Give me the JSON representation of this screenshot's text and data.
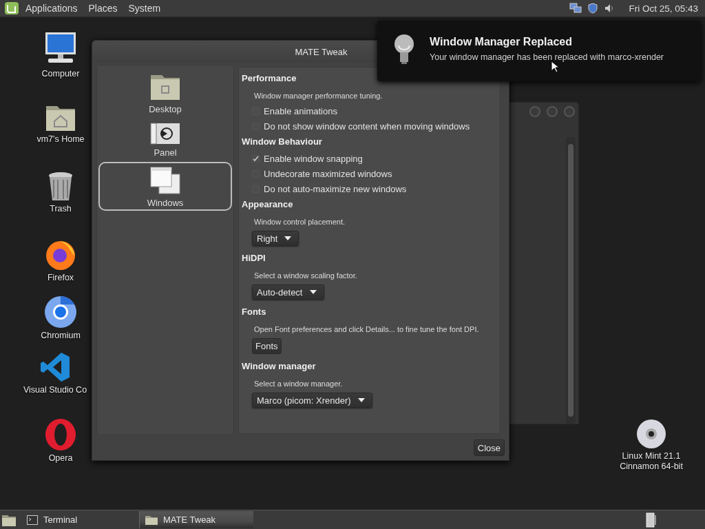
{
  "top_panel": {
    "menus": [
      "Applications",
      "Places",
      "System"
    ],
    "clock": "Fri Oct 25, 05:43"
  },
  "desktop_icons": [
    {
      "kind": "computer",
      "label": "Computer"
    },
    {
      "kind": "home",
      "label": "vm7's Home"
    },
    {
      "kind": "trash",
      "label": "Trash"
    },
    {
      "kind": "firefox",
      "label": "Firefox"
    },
    {
      "kind": "chromium",
      "label": "Chromium"
    },
    {
      "kind": "vscode",
      "label": "Visual Studio Co"
    },
    {
      "kind": "opera",
      "label": "Opera"
    },
    {
      "kind": "disc",
      "label": "Linux Mint 21.1 Cinnamon 64-bit"
    }
  ],
  "window": {
    "title": "MATE Tweak",
    "sidebar": [
      {
        "kind": "desktop",
        "label": "Desktop",
        "selected": false
      },
      {
        "kind": "panel",
        "label": "Panel",
        "selected": false
      },
      {
        "kind": "windows",
        "label": "Windows",
        "selected": true
      }
    ],
    "sections": [
      {
        "title": "Performance",
        "items": [
          {
            "kind": "description",
            "text": "Window manager performance tuning."
          },
          {
            "kind": "checkbox",
            "label": "Enable animations",
            "checked": false
          },
          {
            "kind": "checkbox",
            "label": "Do not show window content when moving windows",
            "checked": false
          }
        ]
      },
      {
        "title": "Window Behaviour",
        "items": [
          {
            "kind": "checkbox",
            "label": "Enable window snapping",
            "checked": true
          },
          {
            "kind": "checkbox",
            "label": "Undecorate maximized windows",
            "checked": false
          },
          {
            "kind": "checkbox",
            "label": "Do not auto-maximize new windows",
            "checked": false
          }
        ]
      },
      {
        "title": "Appearance",
        "items": [
          {
            "kind": "description",
            "text": "Window control placement."
          },
          {
            "kind": "dropdown",
            "value": "Right"
          }
        ]
      },
      {
        "title": "HiDPI",
        "items": [
          {
            "kind": "description",
            "text": "Select a window scaling factor."
          },
          {
            "kind": "dropdown",
            "value": "Auto-detect"
          }
        ]
      },
      {
        "title": "Fonts",
        "items": [
          {
            "kind": "description",
            "text": "Open Font preferences and click Details... to fine tune the font DPI."
          },
          {
            "kind": "button",
            "label": "Fonts"
          }
        ]
      },
      {
        "title": "Window manager",
        "items": [
          {
            "kind": "description",
            "text": "Select a window manager."
          },
          {
            "kind": "dropdown",
            "value": "Marco (picom: Xrender)"
          }
        ]
      }
    ],
    "close_button": "Close"
  },
  "notification": {
    "title": "Window Manager Replaced",
    "body": "Your window manager has been replaced with marco-xrender"
  },
  "taskbar": {
    "items": [
      {
        "kind": "terminal",
        "label": "Terminal",
        "selected": false
      },
      {
        "kind": "tweak",
        "label": "MATE Tweak",
        "selected": true
      }
    ]
  }
}
